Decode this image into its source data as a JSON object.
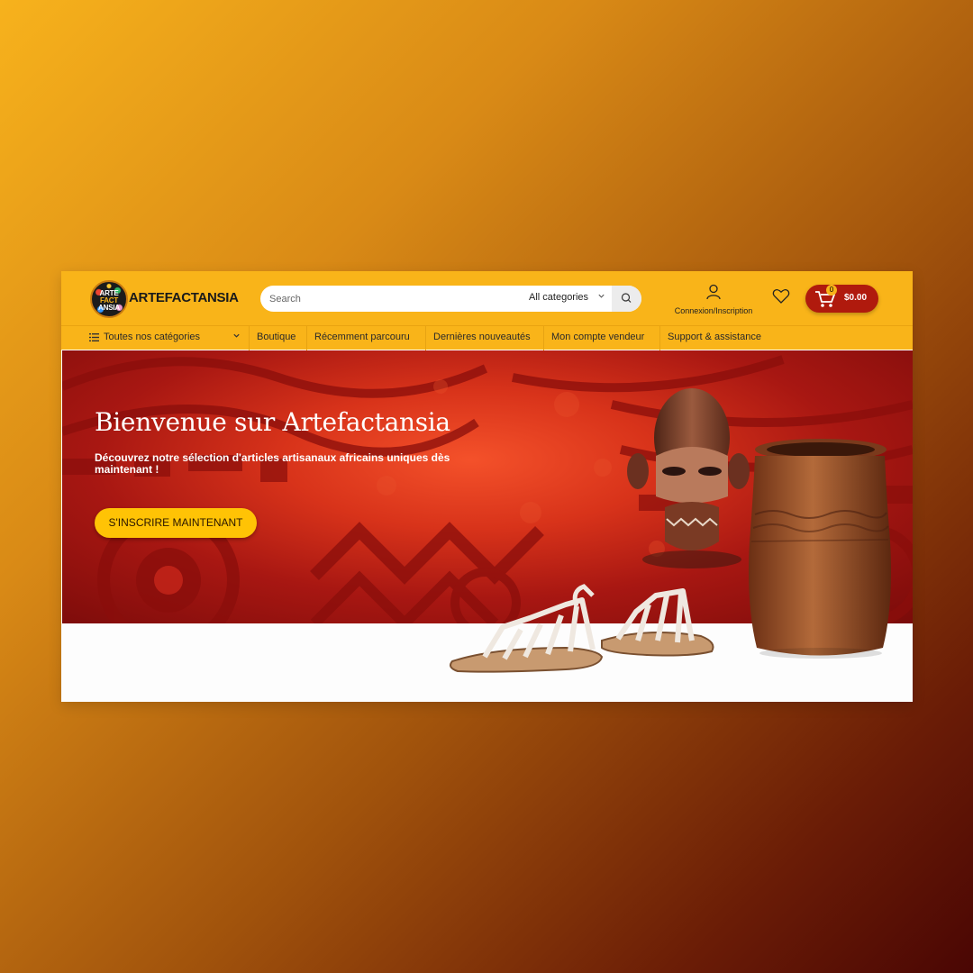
{
  "header": {
    "logo_lines": [
      "ARTE",
      "FACT",
      "ANSIA"
    ],
    "brand_name": "ARTEFACTANSIA",
    "search": {
      "placeholder": "Search",
      "category": "All categories"
    },
    "account_label": "Connexion/Inscription",
    "cart": {
      "count": "0",
      "total": "$0.00"
    }
  },
  "nav": {
    "all_categories": "Toutes nos catégories",
    "items": [
      "Boutique",
      "Récemment parcouru",
      "Dernières nouveautés",
      "Mon compte vendeur",
      "Support & assistance"
    ]
  },
  "hero": {
    "title": "Bienvenue sur Artefactansia",
    "subtitle": "Découvrez notre sélection d'articles artisanaux africains uniques dès maintenant !",
    "cta_label": "S'INSCRIRE MAINTENANT"
  },
  "icons": [
    "list-icon",
    "chevron-down-icon",
    "search-icon",
    "user-icon",
    "heart-icon",
    "cart-icon"
  ],
  "colors": {
    "header": "#f9b419",
    "cart": "#b01a0d",
    "cta": "#ffc305",
    "hero": "#c7261a"
  }
}
